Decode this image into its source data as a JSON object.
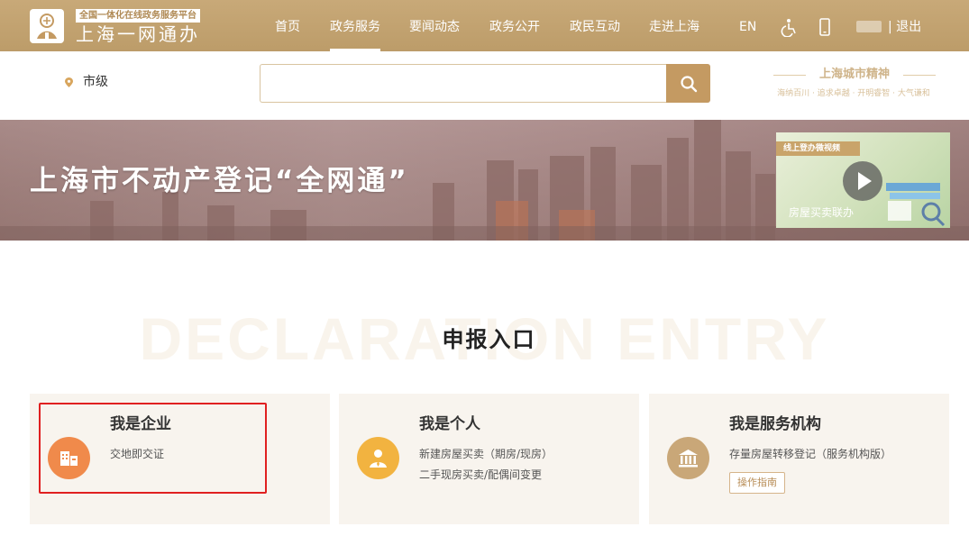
{
  "header": {
    "logo_tag": "全国一体化在线政务服务平台",
    "logo_name": "上海一网通办",
    "nav": [
      "首页",
      "政务服务",
      "要闻动态",
      "政务公开",
      "政民互动",
      "走进上海"
    ],
    "active_nav": "政务服务",
    "lang": "EN",
    "logout": "| 退出"
  },
  "search": {
    "location": "市级",
    "placeholder": "",
    "spirit_title": "上海城市精神",
    "spirit_sub": "海纳百川 · 追求卓越 · 开明睿智 · 大气谦和"
  },
  "banner": {
    "title": "上海市不动产登记“全网通”",
    "video_tag": "线上登办微视频",
    "video_caption": "房屋买卖联办"
  },
  "declaration": {
    "watermark": "DECLARATION ENTRY",
    "title": "申报入口",
    "cards": [
      {
        "title": "我是企业",
        "lines": [
          "交地即交证"
        ],
        "icon_color": "#f08a4b"
      },
      {
        "title": "我是个人",
        "lines": [
          "新建房屋买卖（期房/现房）",
          "二手现房买卖/配偶间变更"
        ],
        "icon_color": "#f2b340"
      },
      {
        "title": "我是服务机构",
        "lines": [
          "存量房屋转移登记（服务机构版）"
        ],
        "button": "操作指南",
        "icon_color": "#c9a778"
      }
    ]
  },
  "colors": {
    "nav_bg": "#c2a26f",
    "accent": "#c49a62",
    "card_bg": "#f8f4ee",
    "highlight": "#e02020"
  }
}
